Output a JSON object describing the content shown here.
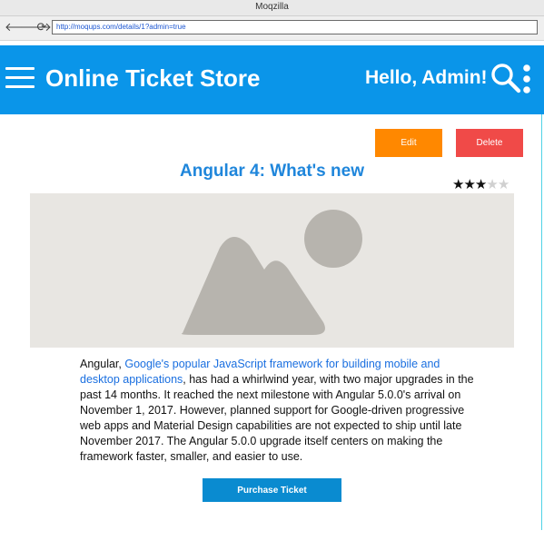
{
  "browser": {
    "window_title": "Moqzilla",
    "url": "http://moqups.com/details/1?admin=true",
    "back_glyph": "🡐",
    "forward_glyph": "🡒",
    "reload_glyph": "⟳"
  },
  "app": {
    "brand": "Online Ticket Store",
    "greeting": "Hello, Admin!"
  },
  "actions": {
    "edit_label": "Edit",
    "delete_label": "Delete",
    "purchase_label": "Purchase Ticket"
  },
  "article": {
    "title": "Angular 4: What's new",
    "rating": 3,
    "rating_max": 5,
    "body_prefix": "Angular, ",
    "body_link": "Google's popular JavaScript framework for building mobile and desktop applications",
    "body_rest": ", has had a whirlwind year, with two major upgrades in the past 14 months. It reached the next milestone with Angular 5.0.0's arrival on November 1, 2017. However, planned support for Google-driven progressive web apps and Material Design capabilities are not expected to ship until late November 2017. The Angular 5.0.0 upgrade itself centers on making the framework faster, smaller, and easier to use."
  },
  "colors": {
    "appbar": "#0a95e9",
    "edit": "#ff8800",
    "delete": "#f04a48",
    "purchase": "#0a8bd0",
    "title": "#1f86db",
    "link": "#1a6fe0",
    "placeholder_bg": "#e8e6e2",
    "placeholder_fg": "#b7b4ae"
  },
  "icons": {
    "menu": "hamburger-menu-icon",
    "search": "search-icon",
    "more": "more-vertical-icon",
    "image": "image-placeholder-icon",
    "star": "star-icon"
  }
}
